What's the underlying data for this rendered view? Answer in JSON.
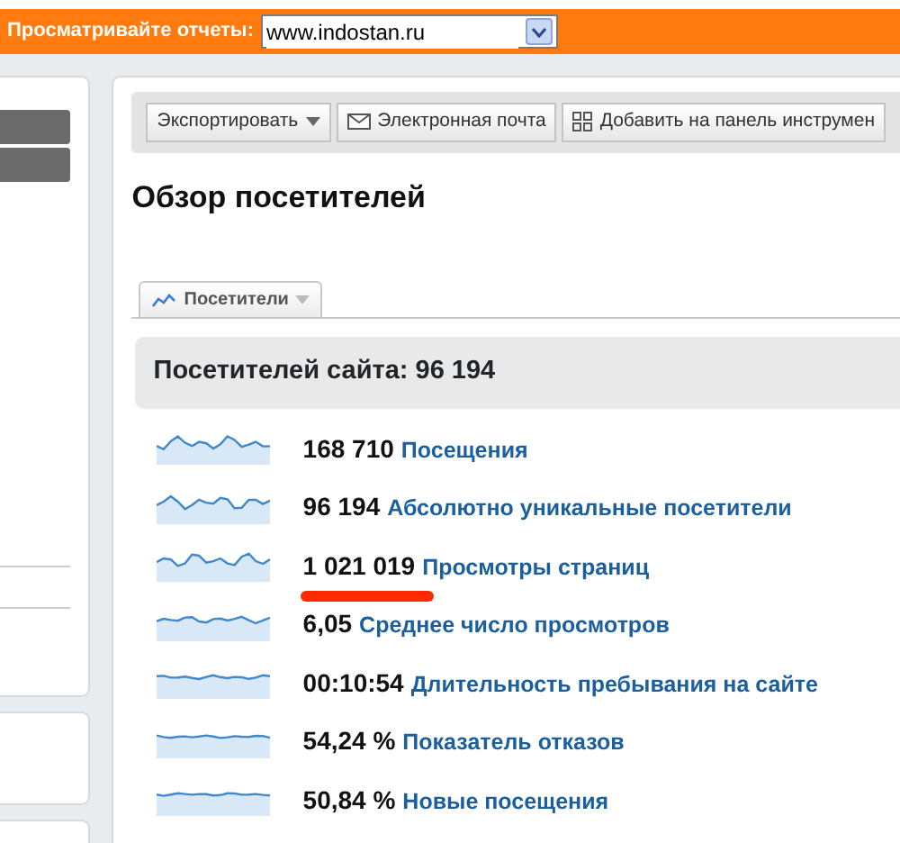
{
  "top_bar": {
    "label": "Просматривайте отчеты:",
    "site_select": {
      "value": "www.indostan.ru"
    }
  },
  "toolbar": {
    "buttons": [
      {
        "label": "Экспортировать",
        "kind": "dropdown"
      },
      {
        "label": "Электронная почта",
        "kind": "email"
      },
      {
        "label": "Добавить на панель инструмен",
        "kind": "dashboard"
      }
    ]
  },
  "title": "Обзор посетителей",
  "chart_tab": {
    "label": "Посетители"
  },
  "summary": "Посетителей сайта: 96 194",
  "metrics": [
    {
      "value": "168 710",
      "label": "Посещения",
      "underlined": false
    },
    {
      "value": "96 194",
      "label": "Абсолютно уникальные посетители",
      "underlined": false
    },
    {
      "value": "1 021 019",
      "label": "Просмотры страниц",
      "underlined": true
    },
    {
      "value": "6,05",
      "label": "Среднее число просмотров",
      "underlined": false
    },
    {
      "value": "00:10:54",
      "label": "Длительность пребывания на сайте",
      "underlined": false
    },
    {
      "value": "54,24 %",
      "label": "Показатель отказов",
      "underlined": false
    },
    {
      "value": "50,84 %",
      "label": "Новые посещения",
      "underlined": false
    }
  ]
}
